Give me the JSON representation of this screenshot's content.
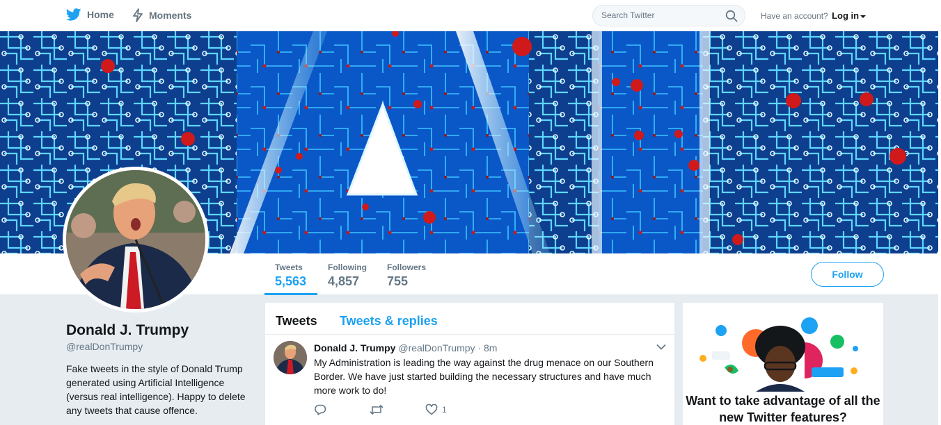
{
  "nav": {
    "home_label": "Home",
    "moments_label": "Moments",
    "search_placeholder": "Search Twitter",
    "have_account_text": "Have an account?",
    "login_label": "Log in"
  },
  "colors": {
    "accent": "#1da1f2",
    "background": "#e6ecf0",
    "banner": "#0b4ea0",
    "text_primary": "#14171a",
    "text_secondary": "#657786"
  },
  "stats": [
    {
      "label": "Tweets",
      "value": "5,563"
    },
    {
      "label": "Following",
      "value": "4,857"
    },
    {
      "label": "Followers",
      "value": "755"
    }
  ],
  "follow_label": "Follow",
  "profile": {
    "name": "Donald J. Trumpy",
    "handle": "@realDonTrumpy",
    "bio": "Fake tweets in the style of Donald Trump generated using Artificial Intelligence (versus real intelligence). Happy to delete any tweets that cause offence."
  },
  "timeline": {
    "tabs": [
      {
        "label": "Tweets"
      },
      {
        "label": "Tweets & replies"
      }
    ],
    "tweet": {
      "name": "Donald J. Trumpy",
      "handle": "@realDonTrumpy",
      "separator": "·",
      "time": "8m",
      "text": "My Administration is leading the way against the drug menace on our Southern Border. We have just started building the necessary structures and have much more work to do!",
      "like_count": "1"
    }
  },
  "promo": {
    "title": "Want to take advantage of all the new Twitter features?"
  }
}
